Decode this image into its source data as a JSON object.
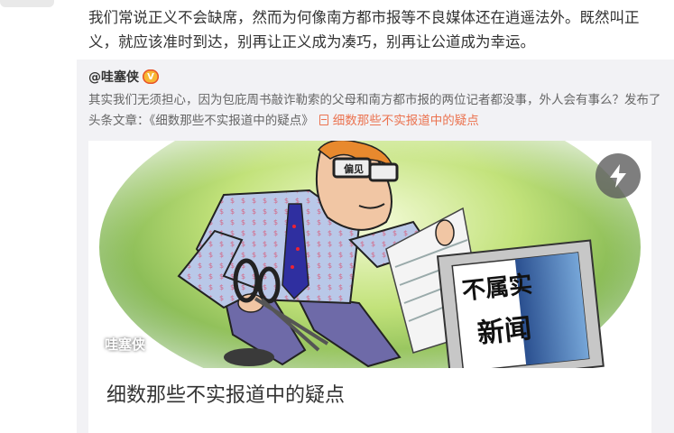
{
  "post": {
    "text": "我们常说正义不会缺席，然而为何像南方都市报等不良媒体还在逍遥法外。既然叫正义，就应该准时到达，别再让正义成为凑巧，别再让公道成为幸运。"
  },
  "repost": {
    "author": "@哇塞侠",
    "badge_text": "V",
    "text": "其实我们无须担心，因为包庇周书敲诈勒索的父母和南方都市报的两位记者都没事，外人会有事么？发布了头条文章：《细数那些不实报道中的疑点》",
    "link_label": "细数那些不实报道中的疑点",
    "link_icon": "document-icon"
  },
  "card": {
    "title": "细数那些不实报道中的疑点",
    "watermark": "哇塞侠",
    "flash_icon": "lightning-icon",
    "glasses_text": "偏见",
    "screen_text_line1": "不属实",
    "screen_text_line2": "新闻"
  },
  "colors": {
    "link": "#eb7350",
    "repost_bg": "#f2f2f5",
    "text_main": "#333333",
    "text_secondary": "#666666"
  }
}
